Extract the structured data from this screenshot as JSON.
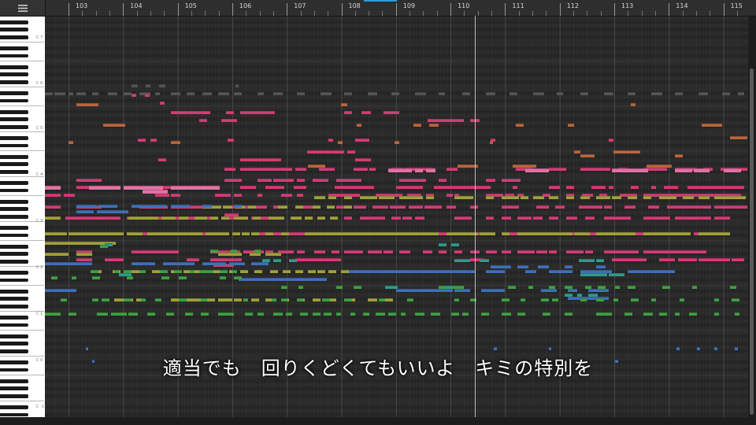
{
  "window": {
    "menu_icon": "hamburger-menu-icon"
  },
  "ruler": {
    "bars": [
      "103",
      "104",
      "105",
      "106",
      "107",
      "108",
      "109",
      "110",
      "111",
      "112",
      "113",
      "114",
      "115"
    ]
  },
  "keyboard": {
    "octave_labels": [
      "C 7",
      "C 6",
      "C 5",
      "C 4",
      "C 3",
      "C 2",
      "C 1",
      "C 0",
      "C -1"
    ]
  },
  "lyrics": {
    "text": "適当でも　回りくどくてもいいよ　キミの特別を"
  },
  "colors": {
    "grid_bg": "#2b2b2b",
    "pink": "#d23c74",
    "light_pink": "#e072a2",
    "orange": "#b8653c",
    "olive": "#9fa13a",
    "blue": "#3f6fb8",
    "green": "#3ea041",
    "teal": "#2e9a8a",
    "gray": "#555555",
    "playhead": "#cfcfcf"
  }
}
